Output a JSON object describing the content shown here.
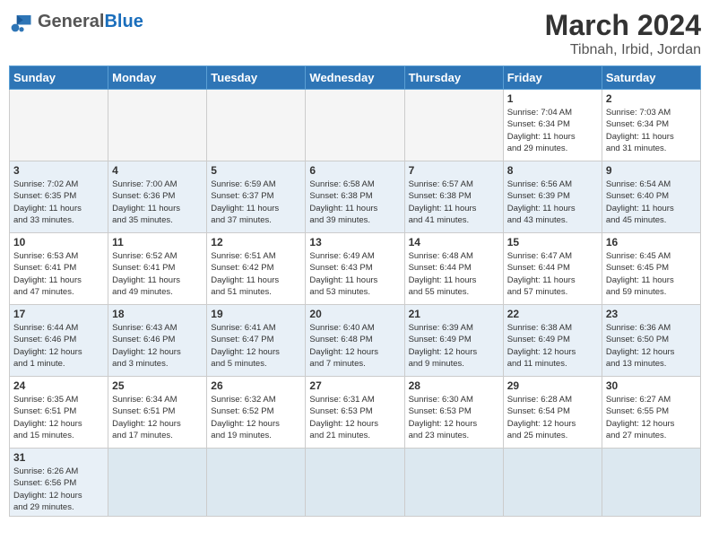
{
  "header": {
    "logo_general": "General",
    "logo_blue": "Blue",
    "month_year": "March 2024",
    "location": "Tibnah, Irbid, Jordan"
  },
  "days_of_week": [
    "Sunday",
    "Monday",
    "Tuesday",
    "Wednesday",
    "Thursday",
    "Friday",
    "Saturday"
  ],
  "weeks": [
    {
      "alt": false,
      "days": [
        {
          "num": "",
          "info": ""
        },
        {
          "num": "",
          "info": ""
        },
        {
          "num": "",
          "info": ""
        },
        {
          "num": "",
          "info": ""
        },
        {
          "num": "",
          "info": ""
        },
        {
          "num": "1",
          "info": "Sunrise: 7:04 AM\nSunset: 6:34 PM\nDaylight: 11 hours\nand 29 minutes."
        },
        {
          "num": "2",
          "info": "Sunrise: 7:03 AM\nSunset: 6:34 PM\nDaylight: 11 hours\nand 31 minutes."
        }
      ]
    },
    {
      "alt": true,
      "days": [
        {
          "num": "3",
          "info": "Sunrise: 7:02 AM\nSunset: 6:35 PM\nDaylight: 11 hours\nand 33 minutes."
        },
        {
          "num": "4",
          "info": "Sunrise: 7:00 AM\nSunset: 6:36 PM\nDaylight: 11 hours\nand 35 minutes."
        },
        {
          "num": "5",
          "info": "Sunrise: 6:59 AM\nSunset: 6:37 PM\nDaylight: 11 hours\nand 37 minutes."
        },
        {
          "num": "6",
          "info": "Sunrise: 6:58 AM\nSunset: 6:38 PM\nDaylight: 11 hours\nand 39 minutes."
        },
        {
          "num": "7",
          "info": "Sunrise: 6:57 AM\nSunset: 6:38 PM\nDaylight: 11 hours\nand 41 minutes."
        },
        {
          "num": "8",
          "info": "Sunrise: 6:56 AM\nSunset: 6:39 PM\nDaylight: 11 hours\nand 43 minutes."
        },
        {
          "num": "9",
          "info": "Sunrise: 6:54 AM\nSunset: 6:40 PM\nDaylight: 11 hours\nand 45 minutes."
        }
      ]
    },
    {
      "alt": false,
      "days": [
        {
          "num": "10",
          "info": "Sunrise: 6:53 AM\nSunset: 6:41 PM\nDaylight: 11 hours\nand 47 minutes."
        },
        {
          "num": "11",
          "info": "Sunrise: 6:52 AM\nSunset: 6:41 PM\nDaylight: 11 hours\nand 49 minutes."
        },
        {
          "num": "12",
          "info": "Sunrise: 6:51 AM\nSunset: 6:42 PM\nDaylight: 11 hours\nand 51 minutes."
        },
        {
          "num": "13",
          "info": "Sunrise: 6:49 AM\nSunset: 6:43 PM\nDaylight: 11 hours\nand 53 minutes."
        },
        {
          "num": "14",
          "info": "Sunrise: 6:48 AM\nSunset: 6:44 PM\nDaylight: 11 hours\nand 55 minutes."
        },
        {
          "num": "15",
          "info": "Sunrise: 6:47 AM\nSunset: 6:44 PM\nDaylight: 11 hours\nand 57 minutes."
        },
        {
          "num": "16",
          "info": "Sunrise: 6:45 AM\nSunset: 6:45 PM\nDaylight: 11 hours\nand 59 minutes."
        }
      ]
    },
    {
      "alt": true,
      "days": [
        {
          "num": "17",
          "info": "Sunrise: 6:44 AM\nSunset: 6:46 PM\nDaylight: 12 hours\nand 1 minute."
        },
        {
          "num": "18",
          "info": "Sunrise: 6:43 AM\nSunset: 6:46 PM\nDaylight: 12 hours\nand 3 minutes."
        },
        {
          "num": "19",
          "info": "Sunrise: 6:41 AM\nSunset: 6:47 PM\nDaylight: 12 hours\nand 5 minutes."
        },
        {
          "num": "20",
          "info": "Sunrise: 6:40 AM\nSunset: 6:48 PM\nDaylight: 12 hours\nand 7 minutes."
        },
        {
          "num": "21",
          "info": "Sunrise: 6:39 AM\nSunset: 6:49 PM\nDaylight: 12 hours\nand 9 minutes."
        },
        {
          "num": "22",
          "info": "Sunrise: 6:38 AM\nSunset: 6:49 PM\nDaylight: 12 hours\nand 11 minutes."
        },
        {
          "num": "23",
          "info": "Sunrise: 6:36 AM\nSunset: 6:50 PM\nDaylight: 12 hours\nand 13 minutes."
        }
      ]
    },
    {
      "alt": false,
      "days": [
        {
          "num": "24",
          "info": "Sunrise: 6:35 AM\nSunset: 6:51 PM\nDaylight: 12 hours\nand 15 minutes."
        },
        {
          "num": "25",
          "info": "Sunrise: 6:34 AM\nSunset: 6:51 PM\nDaylight: 12 hours\nand 17 minutes."
        },
        {
          "num": "26",
          "info": "Sunrise: 6:32 AM\nSunset: 6:52 PM\nDaylight: 12 hours\nand 19 minutes."
        },
        {
          "num": "27",
          "info": "Sunrise: 6:31 AM\nSunset: 6:53 PM\nDaylight: 12 hours\nand 21 minutes."
        },
        {
          "num": "28",
          "info": "Sunrise: 6:30 AM\nSunset: 6:53 PM\nDaylight: 12 hours\nand 23 minutes."
        },
        {
          "num": "29",
          "info": "Sunrise: 6:28 AM\nSunset: 6:54 PM\nDaylight: 12 hours\nand 25 minutes."
        },
        {
          "num": "30",
          "info": "Sunrise: 6:27 AM\nSunset: 6:55 PM\nDaylight: 12 hours\nand 27 minutes."
        }
      ]
    },
    {
      "alt": true,
      "days": [
        {
          "num": "31",
          "info": "Sunrise: 6:26 AM\nSunset: 6:56 PM\nDaylight: 12 hours\nand 29 minutes."
        },
        {
          "num": "",
          "info": ""
        },
        {
          "num": "",
          "info": ""
        },
        {
          "num": "",
          "info": ""
        },
        {
          "num": "",
          "info": ""
        },
        {
          "num": "",
          "info": ""
        },
        {
          "num": "",
          "info": ""
        }
      ]
    }
  ]
}
